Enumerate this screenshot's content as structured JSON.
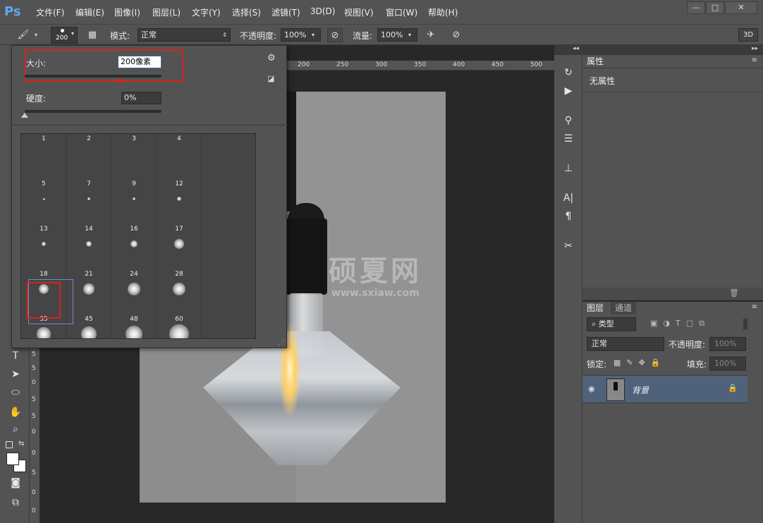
{
  "app": {
    "logo": "Ps"
  },
  "menu": [
    {
      "id": "file",
      "label": "文件(F)"
    },
    {
      "id": "edit",
      "label": "编辑(E)"
    },
    {
      "id": "image",
      "label": "图像(I)"
    },
    {
      "id": "layer",
      "label": "图层(L)"
    },
    {
      "id": "type",
      "label": "文字(Y)"
    },
    {
      "id": "select",
      "label": "选择(S)"
    },
    {
      "id": "filter",
      "label": "滤镜(T)"
    },
    {
      "id": "3d",
      "label": "3D(D)"
    },
    {
      "id": "view",
      "label": "视图(V)"
    },
    {
      "id": "window",
      "label": "窗口(W)"
    },
    {
      "id": "help",
      "label": "帮助(H)"
    }
  ],
  "window_controls": {
    "minimize": "—",
    "maximize": "□",
    "close": "✕"
  },
  "options": {
    "brush_size": "200",
    "mode_label": "模式:",
    "mode_value": "正常",
    "opacity_label": "不透明度:",
    "opacity_value": "100%",
    "flow_label": "流量:",
    "flow_value": "100%",
    "btn_3d": "3D"
  },
  "brush_panel": {
    "size_label": "大小:",
    "size_value": "200像素",
    "size_fraction": 0.3,
    "hardness_label": "硬度:",
    "hardness_value": "0%",
    "hardness_fraction": 0.0,
    "presets": [
      {
        "num": "1"
      },
      {
        "num": "2"
      },
      {
        "num": "3"
      },
      {
        "num": "4"
      },
      {
        "num": "5"
      },
      {
        "num": "7"
      },
      {
        "num": "9"
      },
      {
        "num": "12"
      },
      {
        "num": "13"
      },
      {
        "num": "14"
      },
      {
        "num": "16"
      },
      {
        "num": "17"
      },
      {
        "num": "18"
      },
      {
        "num": "21"
      },
      {
        "num": "24"
      },
      {
        "num": "28"
      },
      {
        "num": "35"
      },
      {
        "num": "45"
      },
      {
        "num": "48"
      },
      {
        "num": "60"
      }
    ],
    "selected_preset": "35"
  },
  "ruler": {
    "top": [
      "200",
      "250",
      "300",
      "350",
      "400",
      "450",
      "500"
    ],
    "left": [
      "5",
      "5",
      "0",
      "5",
      "5",
      "0",
      "0",
      "5",
      "0",
      "0"
    ]
  },
  "watermark": {
    "cn": "硕夏网",
    "en": "www.sxiaw.com"
  },
  "properties": {
    "tab": "属性",
    "content": "无属性"
  },
  "layers": {
    "tab_layers": "图层",
    "tab_channels": "通道",
    "filter_kind": "类型",
    "blend_mode": "正常",
    "opacity_label": "不透明度:",
    "opacity_value": "100%",
    "lock_label": "锁定:",
    "fill_label": "填充:",
    "fill_value": "100%",
    "layer_name": "背景"
  },
  "colors": {
    "accent": "#5fa9e8",
    "highlight": "#d6241c",
    "selected_layer": "#50617a"
  }
}
